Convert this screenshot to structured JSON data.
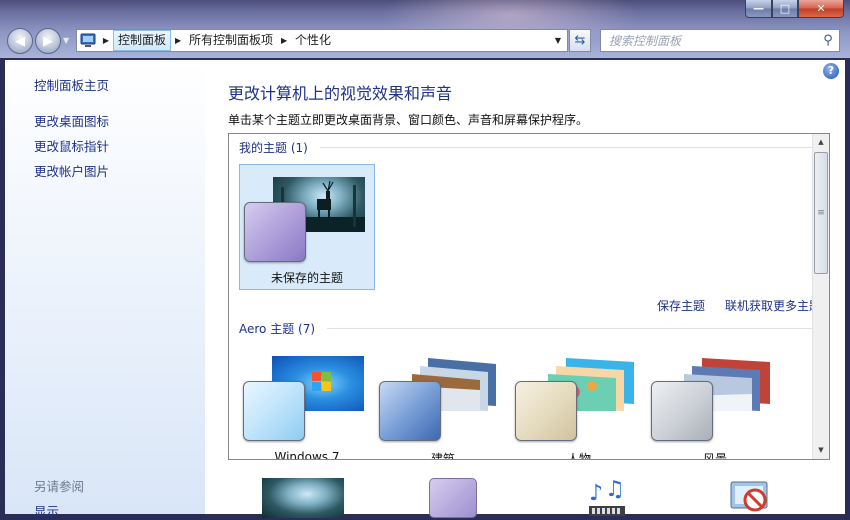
{
  "window": {
    "caption_buttons": {
      "minimize": "—",
      "maximize": "□",
      "close": "✕"
    }
  },
  "nav": {
    "back_glyph": "◀",
    "forward_glyph": "▶",
    "address_icon": "control-panel-icon",
    "breadcrumbs": [
      {
        "label": "控制面板"
      },
      {
        "label": "所有控制面板项"
      },
      {
        "label": "个性化"
      }
    ],
    "search_placeholder": "搜索控制面板"
  },
  "sidebar": {
    "home": "控制面板主页",
    "items": [
      {
        "label": "更改桌面图标"
      },
      {
        "label": "更改鼠标指针"
      },
      {
        "label": "更改帐户图片"
      }
    ],
    "see_also": "另请参阅",
    "see_also_items": [
      {
        "label": "显示"
      }
    ]
  },
  "main": {
    "title": "更改计算机上的视觉效果和声音",
    "subtitle": "单击某个主题立即更改桌面背景、窗口颜色、声音和屏幕保护程序。",
    "my_themes": {
      "header": "我的主题 (1)",
      "items": [
        {
          "label": "未保存的主题",
          "selected": true
        }
      ]
    },
    "links": {
      "save": "保存主题",
      "more": "联机获取更多主题"
    },
    "aero_themes": {
      "header": "Aero 主题 (7)",
      "items": [
        {
          "label": "Windows 7"
        },
        {
          "label": "建筑"
        },
        {
          "label": "人物"
        },
        {
          "label": "风景"
        }
      ]
    }
  },
  "colors": {
    "link": "#1e3287",
    "selection_bg": "#d9ebfb",
    "selection_border": "#8ab7e8"
  }
}
